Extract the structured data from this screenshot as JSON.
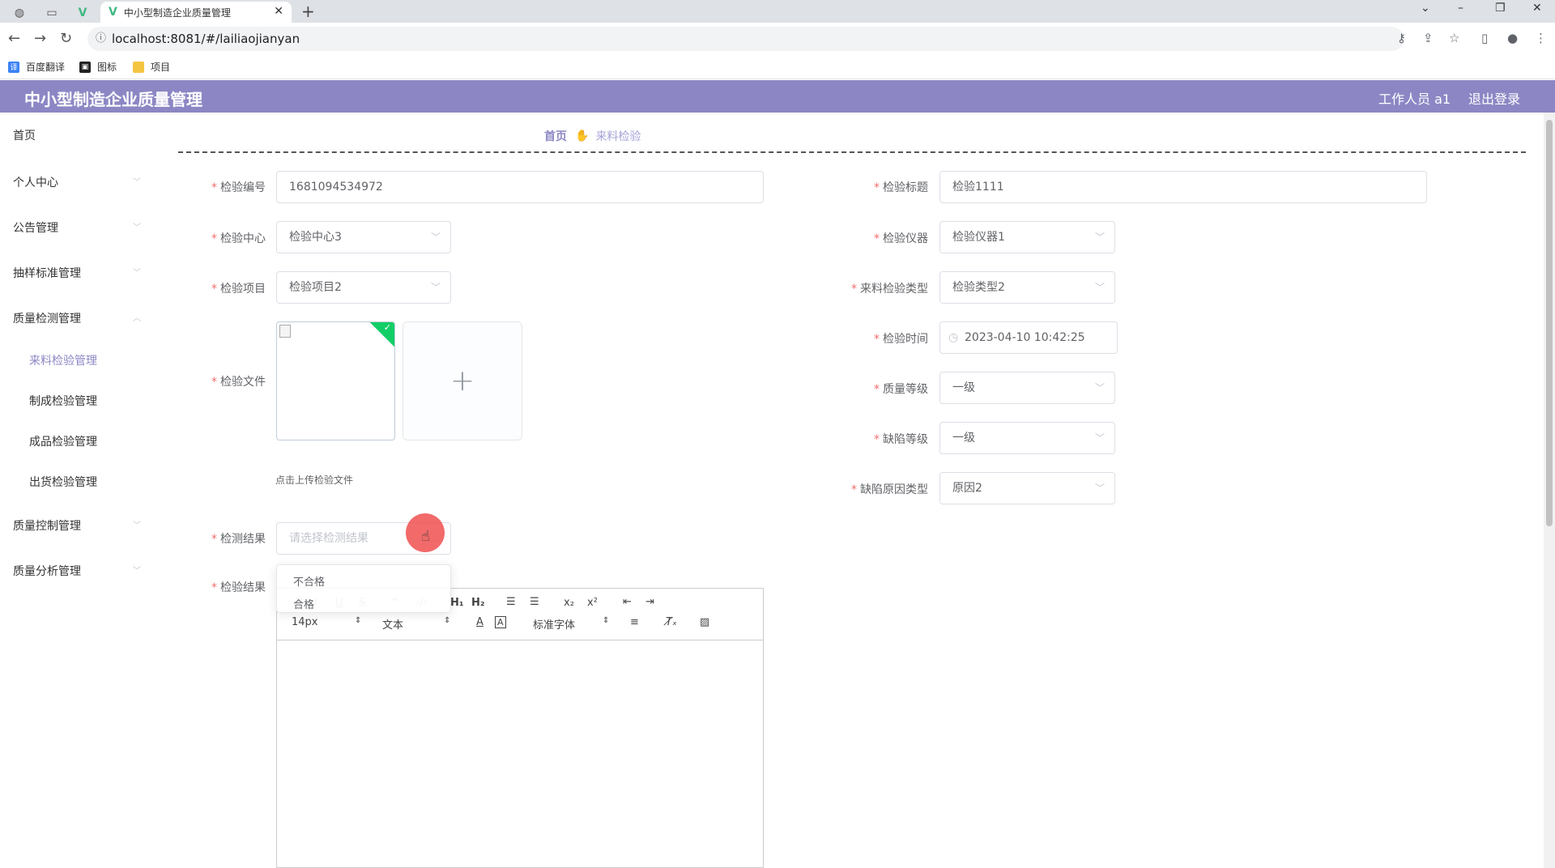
{
  "browser": {
    "tab_title": "中小型制造企业质量管理",
    "url": "localhost:8081/#/lailiaojianyan",
    "bookmarks": [
      "百度翻译",
      "图标",
      "项目"
    ]
  },
  "header": {
    "title": "中小型制造企业质量管理",
    "user": "工作人员 a1",
    "logout": "退出登录"
  },
  "sidebar": {
    "items": [
      {
        "label": "首页"
      },
      {
        "label": "个人中心"
      },
      {
        "label": "公告管理"
      },
      {
        "label": "抽样标准管理"
      },
      {
        "label": "质量检测管理"
      },
      {
        "label": "质量控制管理"
      },
      {
        "label": "质量分析管理"
      }
    ],
    "sub_items": [
      {
        "label": "来料检验管理",
        "active": true
      },
      {
        "label": "制成检验管理"
      },
      {
        "label": "成品检验管理"
      },
      {
        "label": "出货检验管理"
      }
    ]
  },
  "breadcrumb": {
    "home": "首页",
    "current": "来料检验"
  },
  "form": {
    "code": {
      "label": "检验编号",
      "value": "1681094534972"
    },
    "title": {
      "label": "检验标题",
      "value": "检验1111"
    },
    "center": {
      "label": "检验中心",
      "value": "检验中心3"
    },
    "instrument": {
      "label": "检验仪器",
      "value": "检验仪器1"
    },
    "project": {
      "label": "检验项目",
      "value": "检验项目2"
    },
    "type": {
      "label": "来料检验类型",
      "value": "检验类型2"
    },
    "file": {
      "label": "检验文件",
      "hint": "点击上传检验文件"
    },
    "time": {
      "label": "检验时间",
      "value": "2023-04-10 10:42:25"
    },
    "quality": {
      "label": "质量等级",
      "value": "一级"
    },
    "defect": {
      "label": "缺陷等级",
      "value": "一级"
    },
    "cause": {
      "label": "缺陷原因类型",
      "value": "原因2"
    },
    "result_select": {
      "label": "检测结果",
      "placeholder": "请选择检测结果"
    },
    "result_options": [
      "不合格",
      "合格"
    ],
    "result_text": {
      "label": "检验结果"
    }
  },
  "editor": {
    "font_size": "14px",
    "block": "文本",
    "font_family": "标准字体"
  },
  "colors": {
    "header_bg": "#8c87c4",
    "required": "#f56c6c",
    "success": "#13ce66"
  }
}
